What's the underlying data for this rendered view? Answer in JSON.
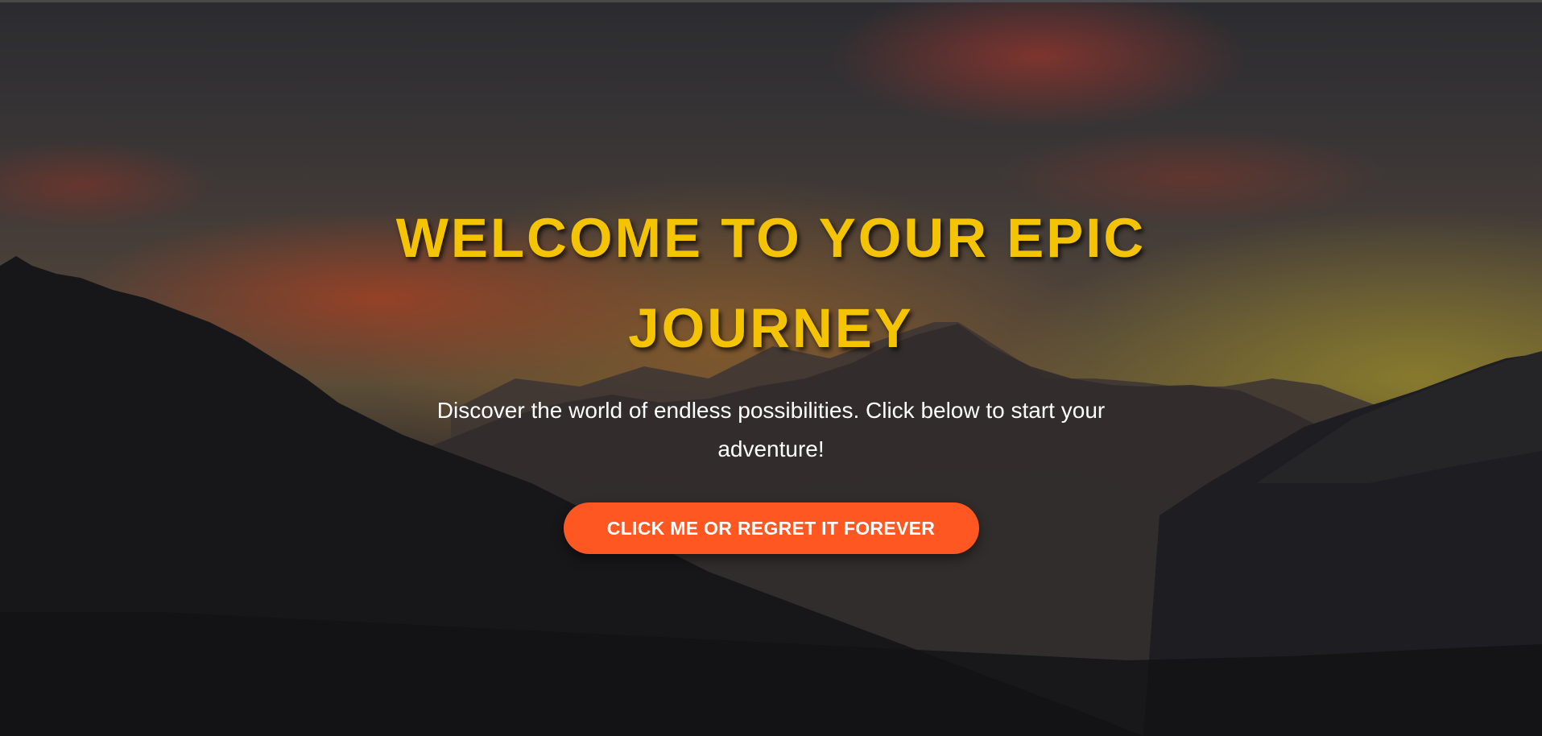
{
  "hero": {
    "title": "WELCOME TO YOUR EPIC JOURNEY",
    "subtitle": "Discover the world of endless possibilities. Click below to start your adventure!",
    "cta_label": "CLICK ME OR REGRET IT FOREVER"
  },
  "colors": {
    "title": "#f5c400",
    "subtitle": "#ffffff",
    "button_background": "#ff5722",
    "button_text": "#ffffff"
  }
}
